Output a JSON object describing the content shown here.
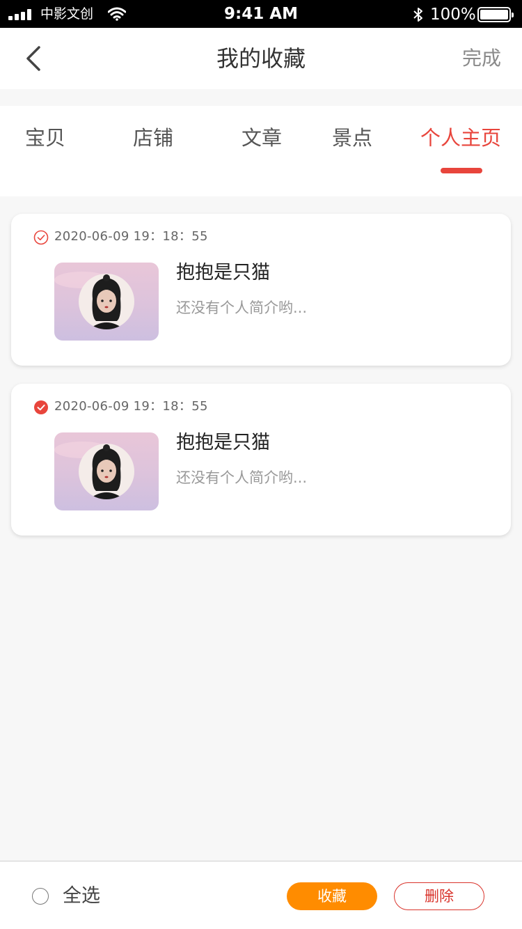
{
  "status_bar": {
    "carrier": "中影文创",
    "time": "9:41 AM",
    "battery": "100%",
    "battery_level": 1.0,
    "icons": [
      "signal-icon",
      "wifi-icon",
      "bluetooth-icon",
      "battery-icon"
    ]
  },
  "nav": {
    "title": "我的收藏",
    "done_label": "完成",
    "back_icon": "chevron-left-icon"
  },
  "tabs": [
    {
      "label": "宝贝",
      "active": false
    },
    {
      "label": "店铺",
      "active": false
    },
    {
      "label": "文章",
      "active": false
    },
    {
      "label": "景点",
      "active": false
    },
    {
      "label": "个人主页",
      "active": true
    }
  ],
  "items": [
    {
      "time": "2020-06-09 19：18：55",
      "name": "抱抱是只猫",
      "bio": "还没有个人简介哟...",
      "checked": false
    },
    {
      "time": "2020-06-09 19：18：55",
      "name": "抱抱是只猫",
      "bio": "还没有个人简介哟...",
      "checked": true
    }
  ],
  "bottom_bar": {
    "select_all_label": "全选",
    "favorite_label": "收藏",
    "delete_label": "删除"
  },
  "colors": {
    "accent": "#e8453c",
    "favorite_button": "#ff8c00",
    "delete_button": "#d9332b",
    "background": "#f7f7f7"
  }
}
